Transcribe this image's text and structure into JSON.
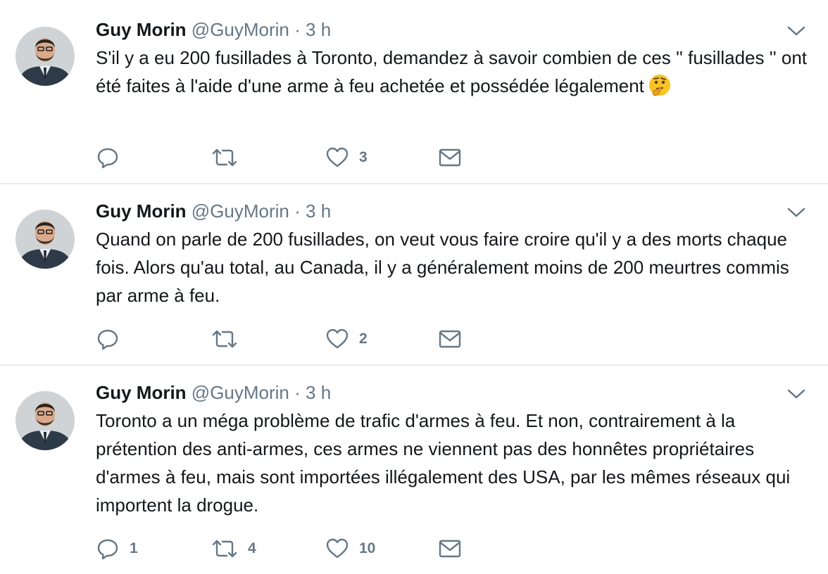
{
  "tweets": [
    {
      "name": "Guy Morin",
      "handle": "@GuyMorin",
      "separator": "·",
      "time": "3 h",
      "text": "S'il y a eu 200 fusillades à Toronto, demandez à savoir combien de ces '' fusillades '' ont été faites à l'aide d'une arme à feu achetée et possédée légalement",
      "emoji": "thinking-face-icon",
      "reply_count": "",
      "retweet_count": "",
      "like_count": "3"
    },
    {
      "name": "Guy Morin",
      "handle": "@GuyMorin",
      "separator": "·",
      "time": "3 h",
      "text": "Quand on parle de 200 fusillades, on veut vous faire croire qu'il y a des morts chaque fois. Alors qu'au total, au Canada, il y a généralement moins de 200 meurtres commis par arme à feu.",
      "reply_count": "",
      "retweet_count": "",
      "like_count": "2"
    },
    {
      "name": "Guy Morin",
      "handle": "@GuyMorin",
      "separator": "·",
      "time": "3 h",
      "text": "Toronto a un méga problème de trafic d'armes à feu. Et non, contrairement à la prétention des anti-armes, ces armes ne viennent pas des honnêtes propriétaires d'armes à feu, mais sont importées illégalement des USA, par les mêmes réseaux qui importent la drogue.",
      "reply_count": "1",
      "retweet_count": "4",
      "like_count": "10"
    }
  ],
  "colors": {
    "text": "#14171a",
    "secondary": "#657786",
    "divider": "#e6ecf0",
    "emoji": "#f7c325"
  }
}
